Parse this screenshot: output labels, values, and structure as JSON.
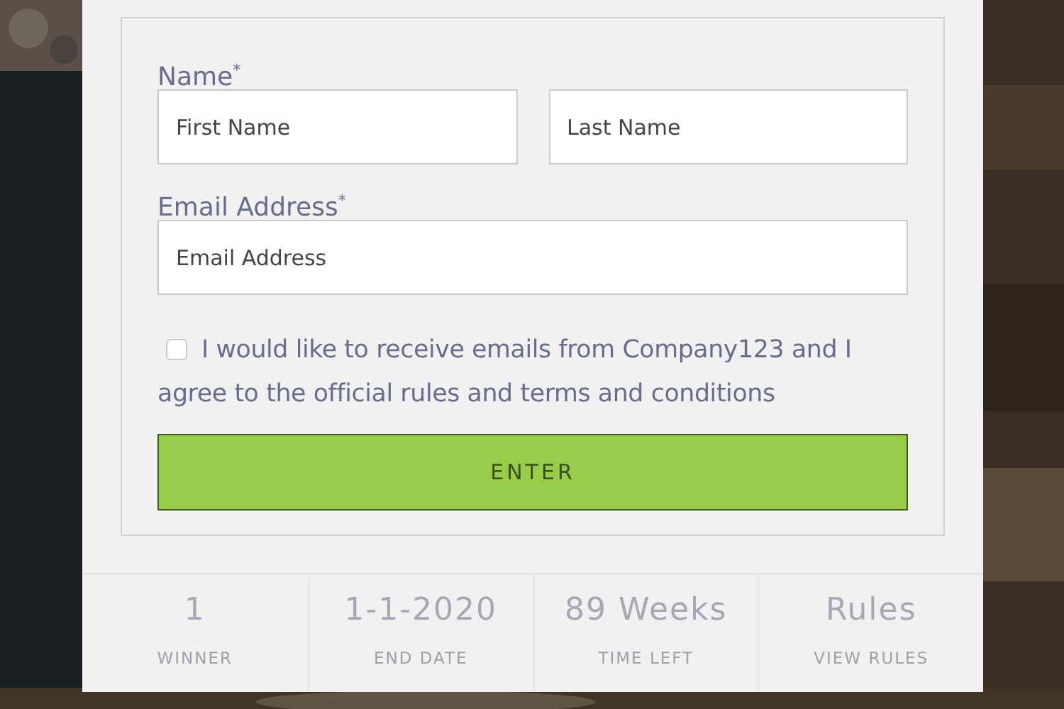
{
  "form": {
    "name_label": "Name$^{*}$",
    "first_name": {
      "placeholder": "First Name"
    },
    "last_name": {
      "placeholder": "Last Name"
    },
    "email_label": "Email Address$^{*}$",
    "email": {
      "placeholder": "Email Address"
    },
    "consent": {
      "checked": false,
      "text": "I would like to receive emails from Company123 and I agree to the official rules and terms and conditions"
    },
    "button": "ENTER"
  },
  "stats": [
    {
      "value": "1",
      "label": "WINNER"
    },
    {
      "value": "1-1-2020",
      "label": "END DATE"
    },
    {
      "value": "89 Weeks",
      "label": "TIME LEFT"
    },
    {
      "value": "Rules",
      "label": "VIEW RULES"
    }
  ]
}
